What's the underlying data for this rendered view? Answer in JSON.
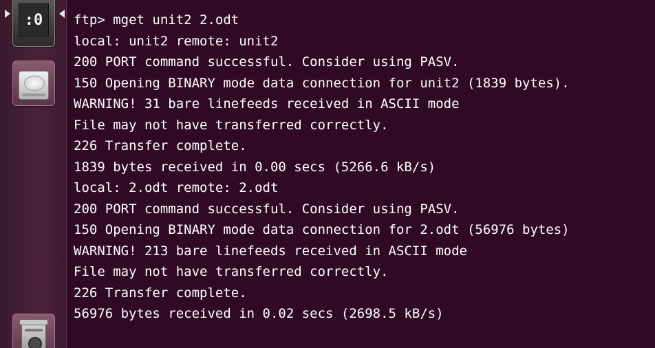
{
  "launcher": {
    "terminal_icon_text": ":0",
    "items": [
      {
        "name": "terminal",
        "icon": "terminal-icon"
      },
      {
        "name": "drive",
        "icon": "hard-drive-icon"
      },
      {
        "name": "trash",
        "icon": "trash-icon"
      }
    ]
  },
  "terminal": {
    "lines": [
      "ftp> mget unit2 2.odt",
      "local: unit2 remote: unit2",
      "200 PORT command successful. Consider using PASV.",
      "150 Opening BINARY mode data connection for unit2 (1839 bytes).",
      "WARNING! 31 bare linefeeds received in ASCII mode",
      "File may not have transferred correctly.",
      "226 Transfer complete.",
      "1839 bytes received in 0.00 secs (5266.6 kB/s)",
      "local: 2.odt remote: 2.odt",
      "200 PORT command successful. Consider using PASV.",
      "150 Opening BINARY mode data connection for 2.odt (56976 bytes)",
      "WARNING! 213 bare linefeeds received in ASCII mode",
      "File may not have transferred correctly.",
      "226 Transfer complete.",
      "56976 bytes received in 0.02 secs (2698.5 kB/s)"
    ]
  },
  "colors": {
    "background": "#300a24",
    "text": "#ffffff"
  }
}
